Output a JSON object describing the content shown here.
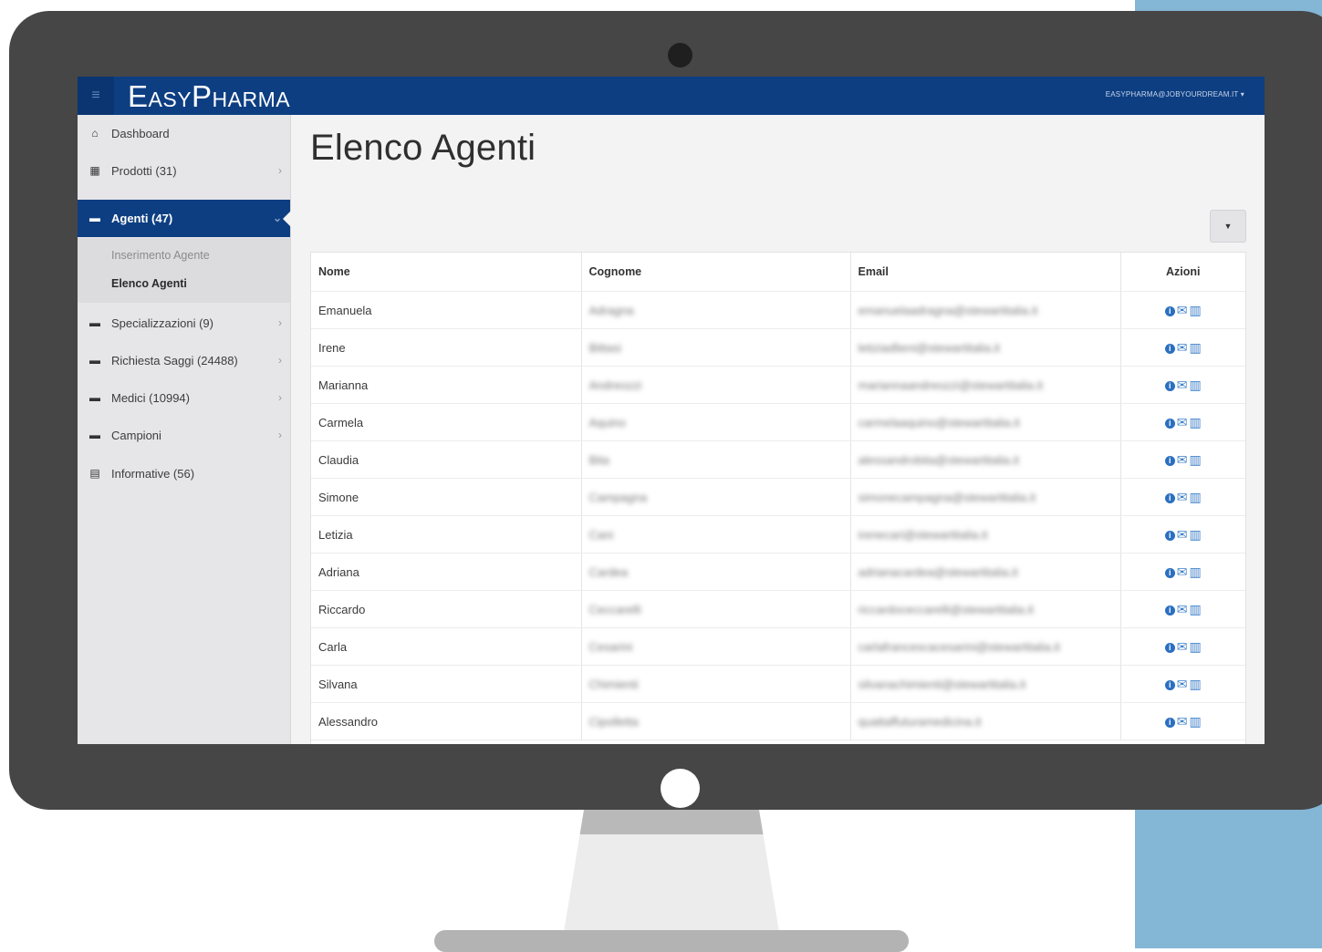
{
  "brand": "EasyPharma",
  "user_menu": "EASYPHARMA@JOBYOURDREAM.IT ▾",
  "menu_icon": "hamburger-icon",
  "sidebar": {
    "items": [
      {
        "label": "Dashboard",
        "icon": "home-icon",
        "chevron": ""
      },
      {
        "label": "Prodotti (31)",
        "icon": "grid-icon",
        "chevron": "›"
      },
      {
        "label": "Agenti (47)",
        "icon": "briefcase-icon",
        "chevron": "⌄"
      },
      {
        "label": "Specializzazioni (9)",
        "icon": "briefcase-icon",
        "chevron": "›"
      },
      {
        "label": "Richiesta Saggi (24488)",
        "icon": "briefcase-icon",
        "chevron": "›"
      },
      {
        "label": "Medici (10994)",
        "icon": "briefcase-icon",
        "chevron": "›"
      },
      {
        "label": "Campioni",
        "icon": "briefcase-icon",
        "chevron": "›"
      },
      {
        "label": "Informative (56)",
        "icon": "document-icon",
        "chevron": ""
      }
    ],
    "sub_items": [
      "Inserimento Agente",
      "Elenco Agenti"
    ]
  },
  "page_title": "Elenco Agenti",
  "dropdown_caret": "▼",
  "table": {
    "headers": [
      "Nome",
      "Cognome",
      "Email",
      "Azioni"
    ],
    "rows": [
      [
        "Emanuela",
        "Adragna",
        "emanuelaadragna@stewartitalia.it"
      ],
      [
        "Irene",
        "Bittasi",
        "letiziadlieni@stewartitalia.it"
      ],
      [
        "Marianna",
        "Andreozzi",
        "mariannaandreozzi@stewartitalia.it"
      ],
      [
        "Carmela",
        "Aquino",
        "carmelaaquino@stewartitalia.it"
      ],
      [
        "Claudia",
        "Bita",
        "alessandrobita@stewartitalia.it"
      ],
      [
        "Simone",
        "Campagna",
        "simonecampagna@stewartitalia.it"
      ],
      [
        "Letizia",
        "Cani",
        "irenecari@stewartitalia.it"
      ],
      [
        "Adriana",
        "Cardea",
        "adrianacardea@stewartitalia.it"
      ],
      [
        "Riccardo",
        "Ceccarelli",
        "riccardoceccarelli@stewartitalia.it"
      ],
      [
        "Carla",
        "Cesarini",
        "carlafrancescacesarini@stewartitalia.it"
      ],
      [
        "Silvana",
        "Chimienti",
        "silvanachimienti@stewartitalia.it"
      ],
      [
        "Alessandro",
        "Cipolletta",
        "quattaffuturamedicina.it"
      ]
    ],
    "action_icons": [
      "info-icon",
      "envelope-icon",
      "trash-icon"
    ]
  }
}
